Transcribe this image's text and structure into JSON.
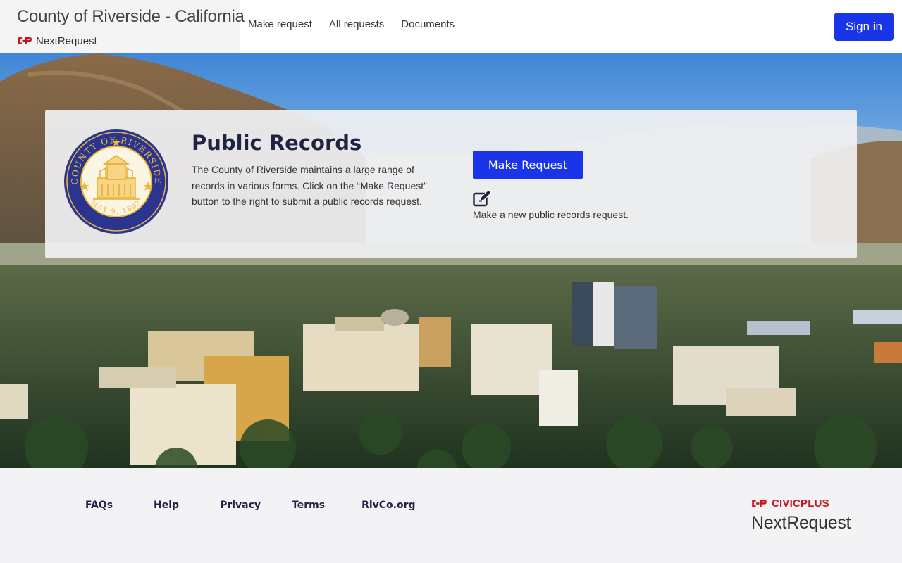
{
  "header": {
    "title": "County of Riverside - California",
    "subtitle": "NextRequest",
    "nav": [
      {
        "label": "Make request"
      },
      {
        "label": "All requests"
      },
      {
        "label": "Documents"
      }
    ],
    "sign_in_label": "Sign in"
  },
  "hero": {
    "title": "Public Records",
    "description": "The County of Riverside maintains a large range of records in various forms. Click on the “Make Request” button to the right to submit a public records request.",
    "button_label": "Make Request",
    "note": "Make a new public records request.",
    "seal_top_text": "COUNTY OF RIVERSIDE",
    "seal_bottom_text": "MAY 9, 1893"
  },
  "footer": {
    "links": [
      {
        "label": "FAQs"
      },
      {
        "label": "Help"
      },
      {
        "label": "Privacy"
      },
      {
        "label": "Terms"
      },
      {
        "label": "RivCo.org"
      }
    ],
    "brand_top": "CIVICPLUS",
    "brand_bottom": "NextRequest"
  },
  "colors": {
    "primary": "#1a34e8",
    "heading": "#1f2340",
    "brand_red": "#c4161c",
    "seal_blue": "#2a3590",
    "seal_gold": "#f0b83a"
  },
  "icons": [
    "civicplus-logo-icon",
    "edit-icon",
    "county-seal-icon"
  ]
}
